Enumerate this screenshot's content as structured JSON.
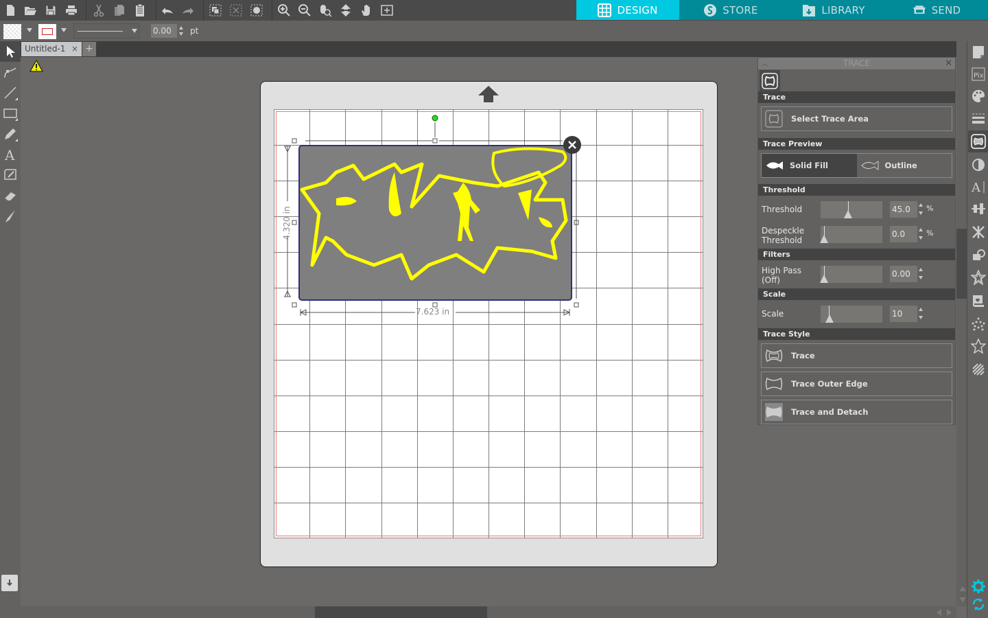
{
  "toolbar": {
    "buttons": [
      "new-document",
      "open",
      "save",
      "print",
      "cut",
      "copy",
      "paste",
      "undo",
      "redo",
      "group",
      "ungroup",
      "compound-path",
      "zoom-in",
      "zoom-out",
      "zoom-select",
      "move-to-mat",
      "pan",
      "fit-to-page"
    ]
  },
  "nav": {
    "tabs": [
      {
        "label": "DESIGN",
        "icon": "grid-icon",
        "active": true
      },
      {
        "label": "STORE",
        "icon": "silhouette-s-icon",
        "active": false
      },
      {
        "label": "LIBRARY",
        "icon": "library-download-icon",
        "active": false
      },
      {
        "label": "SEND",
        "icon": "cutter-icon",
        "active": false
      }
    ],
    "colors": {
      "bar": "#018a98",
      "active": "#00c8e0"
    }
  },
  "toolbar2": {
    "fill_swatch": "transparent",
    "line_color": "#cc2222",
    "line_width_value": "0.00",
    "line_width_unit": "pt"
  },
  "document": {
    "tab_label": "Untitled-1",
    "tab_close": "×",
    "add_tab": "+",
    "warning": "warning-icon"
  },
  "canvas": {
    "width_label": "7.623 in",
    "height_label": "4.320 in",
    "image_color": "#ffff00",
    "selection_border": "#2e3278"
  },
  "trace_panel": {
    "title": "TRACE",
    "sections": {
      "trace": "Trace",
      "trace_preview": "Trace Preview",
      "threshold": "Threshold",
      "filters": "Filters",
      "scale": "Scale",
      "trace_style": "Trace Style"
    },
    "select_trace_area": "Select Trace Area",
    "preview": {
      "solid_fill": "Solid Fill",
      "outline": "Outline",
      "selected": "Solid Fill"
    },
    "threshold": {
      "label": "Threshold",
      "value": "45.0",
      "unit": "%",
      "fraction": 0.45
    },
    "despeckle": {
      "label_line1": "Despeckle",
      "label_line2": "Threshold",
      "value": "0.0",
      "unit": "%",
      "fraction": 0.0
    },
    "high_pass": {
      "label_line1": "High Pass",
      "label_line2": "(Off)",
      "value": "0.00",
      "fraction": 0.0
    },
    "scale": {
      "label": "Scale",
      "value": "10",
      "fraction": 0.1
    },
    "styles": {
      "trace": "Trace",
      "trace_outer_edge": "Trace Outer Edge",
      "trace_and_detach": "Trace and Detach"
    }
  },
  "right_bar": {
    "icons": [
      "page-setup-icon",
      "pixscan-icon",
      "fill-panel-icon",
      "line-style-icon",
      "trace-icon",
      "contrast-icon",
      "text-style-icon",
      "align-icon",
      "replicate-icon",
      "modify-icon",
      "offset-icon",
      "sketch-icon",
      "rhinestone-icon",
      "star-icon",
      "hatch-icon"
    ],
    "bottom": [
      "settings-gear-icon",
      "sync-icon"
    ],
    "accent": "#00c8e0"
  }
}
